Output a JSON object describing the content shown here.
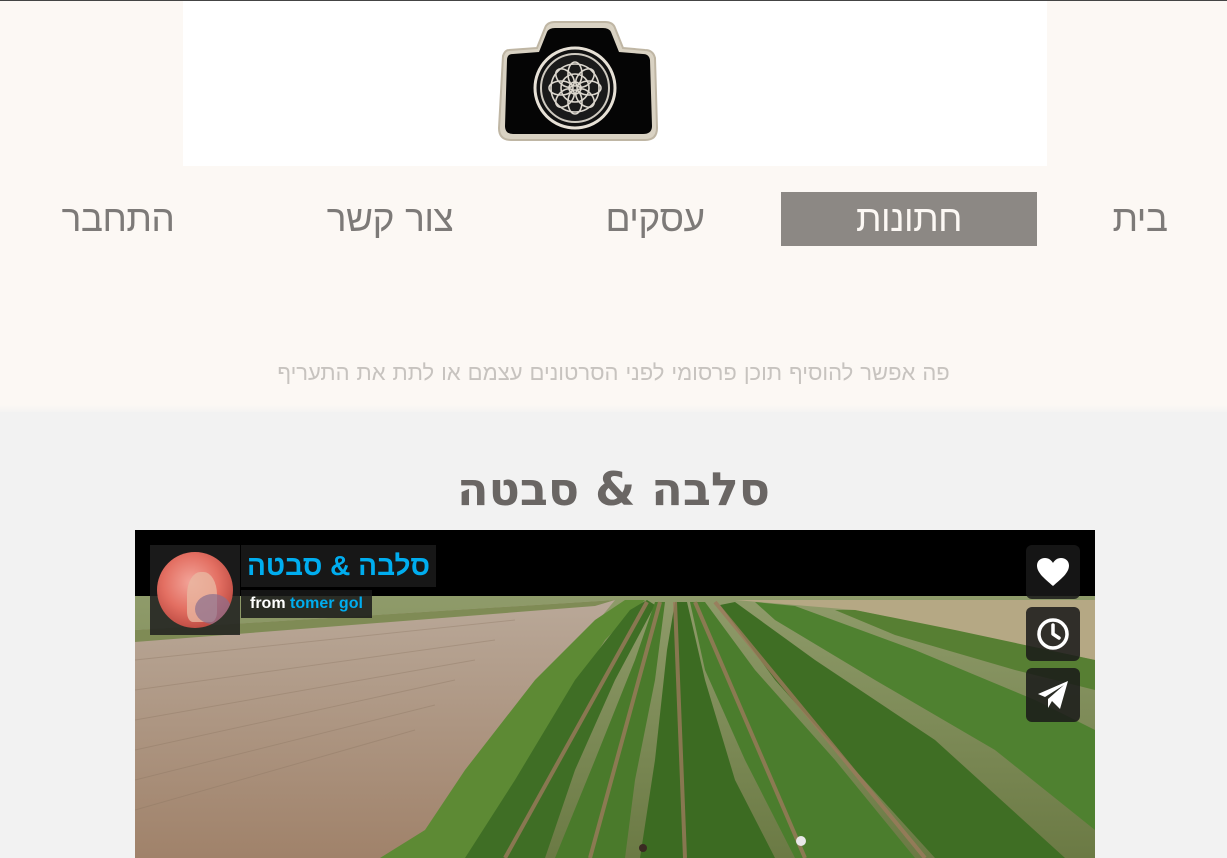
{
  "nav": {
    "items": [
      {
        "label": "בית",
        "active": false
      },
      {
        "label": "חתונות",
        "active": true
      },
      {
        "label": "עסקים",
        "active": false
      },
      {
        "label": "צור קשר",
        "active": false
      },
      {
        "label": "התחבר",
        "active": false
      }
    ]
  },
  "promo_text": "פה אפשר להוסיף תוכן פרסומי לפני הסרטונים עצמם או לתת את התעריף",
  "video": {
    "page_title": "סלבה & סבטה",
    "player_title": "סלבה & סבטה",
    "byline_prefix": "from",
    "author": "tomer gol",
    "actions": [
      "heart-icon",
      "clock-icon",
      "send-icon"
    ]
  },
  "colors": {
    "page_bg": "#fcf8f4",
    "nav_active_bg": "#8c8884",
    "accent": "#00adef",
    "section_bg": "#f2f2f2"
  }
}
